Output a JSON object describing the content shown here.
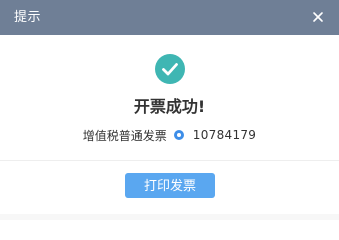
{
  "dialog": {
    "title": "提示",
    "close_icon": "close-icon"
  },
  "status": {
    "icon": "check-circle-icon",
    "icon_color": "#3fb6b3",
    "heading": "开票成功!"
  },
  "invoice": {
    "type_label": "增值税普通发票",
    "number": "10784179",
    "marker_icon": "dot-icon",
    "marker_color": "#3d8ee8"
  },
  "actions": {
    "print_label": "打印发票",
    "accent_color": "#5aa7f0"
  }
}
